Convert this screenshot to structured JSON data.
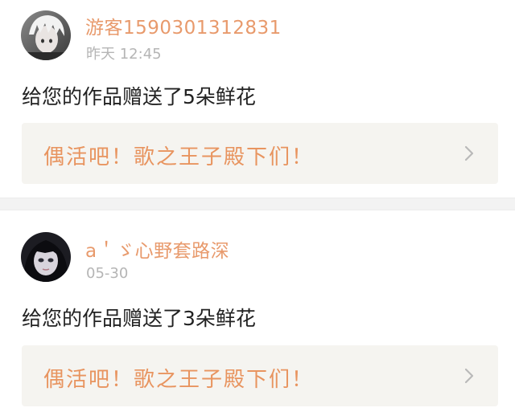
{
  "notifications": [
    {
      "user": "游客1590301312831",
      "time": "昨天 12:45",
      "message": "给您的作品赠送了5朵鲜花",
      "work_title": "偶活吧！歌之王子殿下们！",
      "avatar": "avatar-silver-hair"
    },
    {
      "user": "a＇ゞ心野套路深",
      "time": "05-30",
      "message": "给您的作品赠送了3朵鲜花",
      "work_title": "偶活吧！歌之王子殿下们！",
      "avatar": "avatar-dark-hair"
    }
  ],
  "colors": {
    "username": "#e89a6c",
    "work_title": "#e8945f",
    "card_bg": "#f5f4f0",
    "time": "#b5b5b5",
    "message": "#222222"
  },
  "icons": {
    "card_arrow": "chevron-right-icon"
  }
}
